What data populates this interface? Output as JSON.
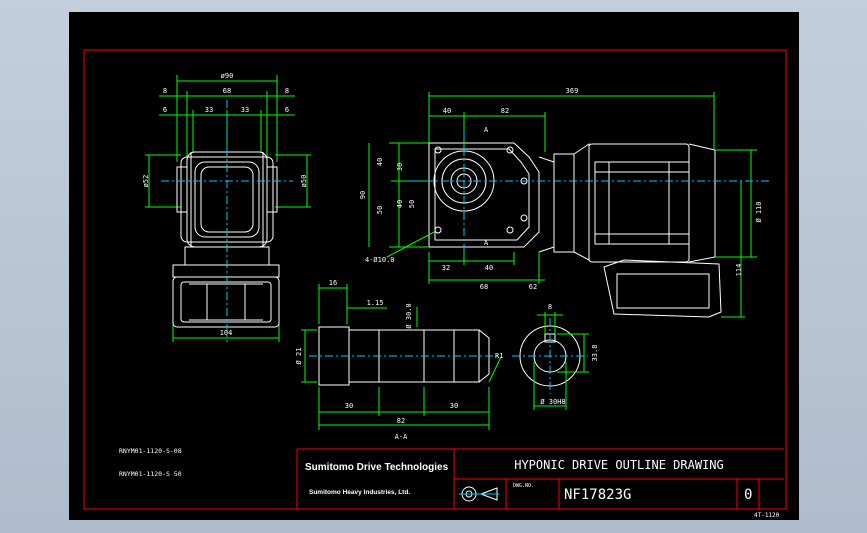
{
  "colors": {
    "background": "#000000",
    "frame": "#ff0000",
    "outline": "#ffffff",
    "dimension": "#00ff00",
    "center": "#00c8ff",
    "text_white": "#ffffff"
  },
  "views": {
    "left": {
      "dims": {
        "d90": "ø90",
        "d68": "68",
        "s8a": "8",
        "s8b": "8",
        "s6a": "6",
        "s33a": "33",
        "s33b": "33",
        "s6b": "6",
        "phi52": "ø52",
        "phi50": "ø50",
        "d104": "104"
      }
    },
    "front": {
      "dims": {
        "d369": "369",
        "d40": "40",
        "d82": "82",
        "d40v": "40",
        "d30v": "30",
        "d90v": "90",
        "d50v": "50",
        "d40v2": "40",
        "d50v2": "50",
        "holes": "4-Ø10.0",
        "d32": "32",
        "d40b": "40",
        "d68b": "68",
        "d62": "62",
        "d110": "Ø 110",
        "d114": "114"
      },
      "sectionA": "A",
      "sectionA2": "A"
    },
    "shaft": {
      "dims": {
        "d16": "16",
        "d115": "1.15",
        "d300": "Ø 30.0",
        "d21": "Ø 21",
        "d30a": "30",
        "d30b": "30",
        "d82": "82",
        "r1": "R1"
      },
      "section_label": "A-A"
    },
    "key": {
      "dims": {
        "d8": "8",
        "d338": "33.8",
        "d30h8": "Ø 30H8"
      }
    }
  },
  "notes": {
    "note1": "RNYM01-1120-S-08",
    "note2": "RNYM01-1120-S 50"
  },
  "title_block": {
    "brand": "Sumitomo Drive Technologies",
    "subbrand": "Sumitomo Heavy Industries, Ltd.",
    "title": "HYPONIC DRIVE OUTLINE DRAWING",
    "dwg_label": "DWG.NO.",
    "drawing_no": "NF17823G",
    "revision": "0",
    "sheet_code": "4T-1120"
  }
}
